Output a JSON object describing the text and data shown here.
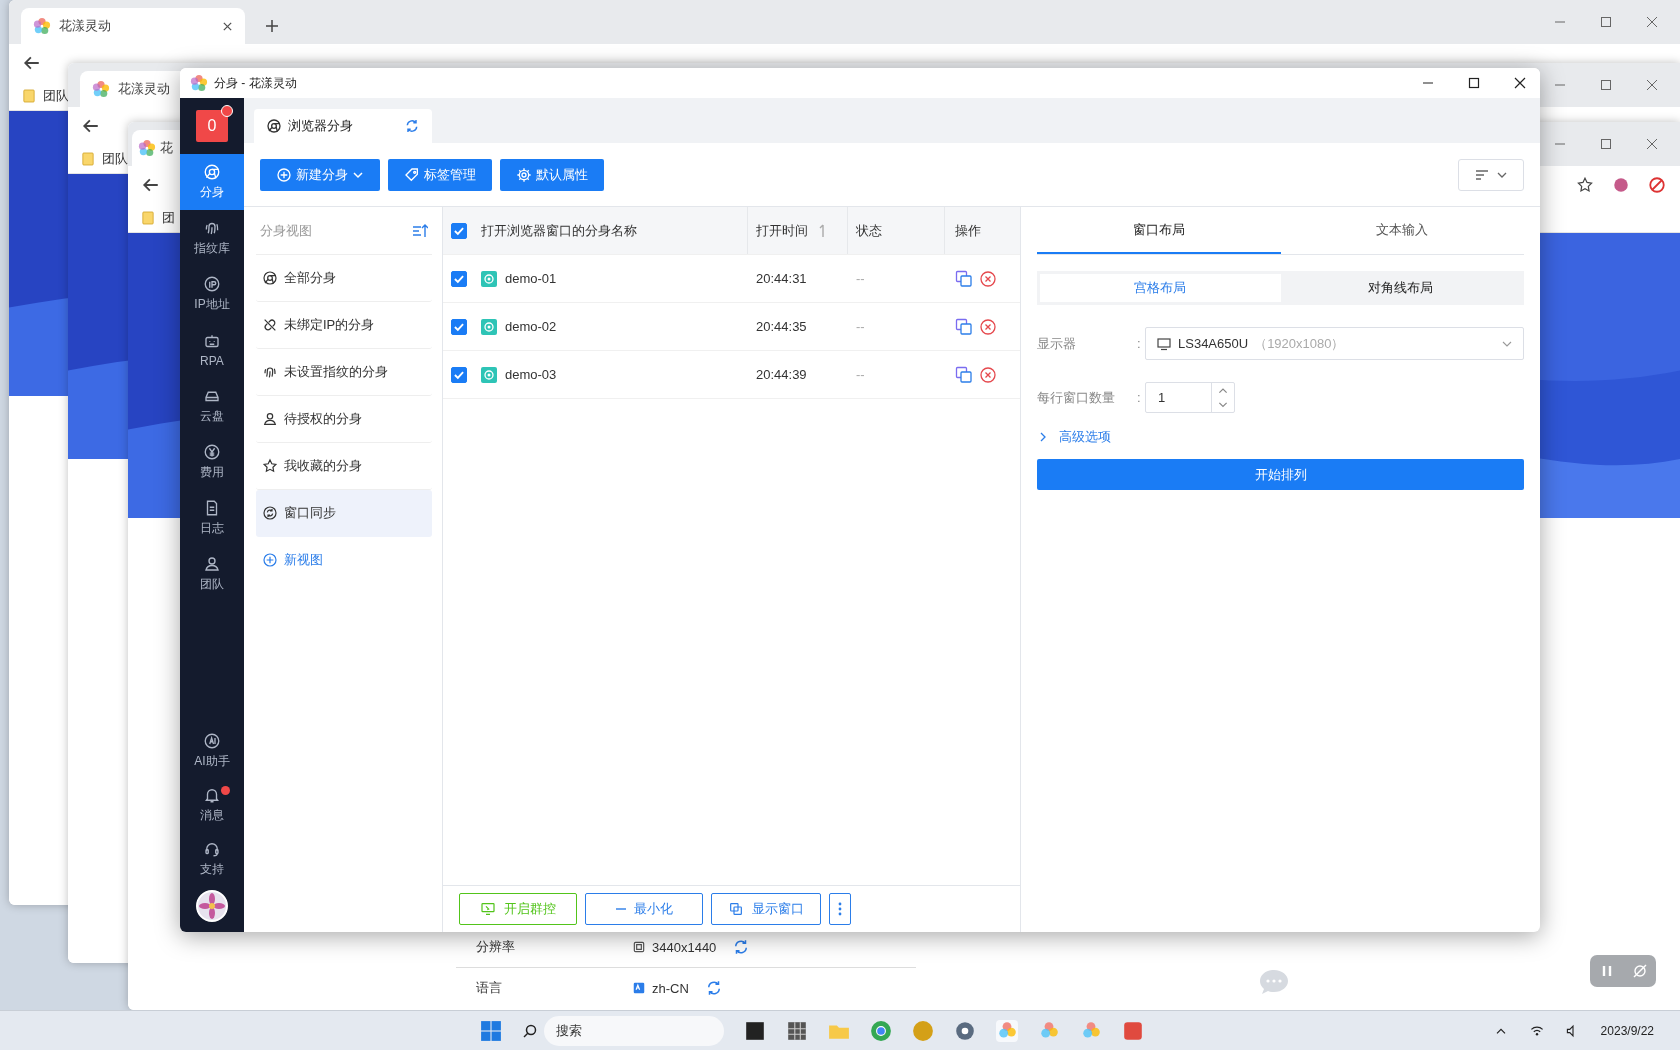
{
  "desktop": {
    "browser_windows": [
      {
        "tab_title": "花漾灵动",
        "bookmark": "团队"
      },
      {
        "tab_title": "花漾灵动",
        "bookmark": "团队"
      },
      {
        "tab_title": "花",
        "bookmark": "团"
      }
    ],
    "settings_rows": [
      {
        "label": "分辨率",
        "value": "3440x1440"
      },
      {
        "label": "语言",
        "value": "zh-CN"
      }
    ]
  },
  "app": {
    "window": {
      "title": "分身 - 花漾灵动"
    },
    "sidebar": {
      "badge": "0",
      "badge_dot": true,
      "items": [
        {
          "label": "分身",
          "selected": true,
          "dot": false
        },
        {
          "label": "指纹库",
          "selected": false,
          "dot": false
        },
        {
          "label": "IP地址",
          "selected": false,
          "dot": false
        },
        {
          "label": "RPA",
          "selected": false,
          "dot": false
        },
        {
          "label": "云盘",
          "selected": false,
          "dot": false
        },
        {
          "label": "费用",
          "selected": false,
          "dot": false
        },
        {
          "label": "日志",
          "selected": false,
          "dot": false
        },
        {
          "label": "团队",
          "selected": false,
          "dot": false
        }
      ],
      "bottom_items": [
        {
          "label": "AI助手",
          "selected": false,
          "dot": false
        },
        {
          "label": "消息",
          "selected": false,
          "dot": true
        },
        {
          "label": "支持",
          "selected": false,
          "dot": false
        }
      ]
    },
    "tab": {
      "label": "浏览器分身"
    },
    "toolbar": [
      {
        "label": "新建分身",
        "dropdown": true
      },
      {
        "label": "标签管理",
        "dropdown": false
      },
      {
        "label": "默认属性",
        "dropdown": false
      }
    ],
    "views": {
      "title": "分身视图",
      "items": [
        {
          "label": "全部分身",
          "selected": false
        },
        {
          "label": "未绑定IP的分身",
          "selected": false
        },
        {
          "label": "未设置指纹的分身",
          "selected": false
        },
        {
          "label": "待授权的分身",
          "selected": false
        },
        {
          "label": "我收藏的分身",
          "selected": false
        },
        {
          "label": "窗口同步",
          "selected": true
        }
      ],
      "new_view": "新视图"
    },
    "table": {
      "all_checked": true,
      "columns": [
        "打开浏览器窗口的分身名称",
        "打开时间",
        "状态",
        "操作"
      ],
      "rows": [
        {
          "checked": true,
          "name": "demo-01",
          "open_time": "20:44:31",
          "status": "--"
        },
        {
          "checked": true,
          "name": "demo-02",
          "open_time": "20:44:35",
          "status": "--"
        },
        {
          "checked": true,
          "name": "demo-03",
          "open_time": "20:44:39",
          "status": "--"
        }
      ],
      "actions": [
        {
          "label": "开启群控",
          "kind": "group"
        },
        {
          "label": "最小化",
          "kind": "minimize"
        },
        {
          "label": "显示窗口",
          "kind": "show"
        }
      ]
    },
    "panel": {
      "tabs": [
        {
          "label": "窗口布局",
          "selected": true
        },
        {
          "label": "文本输入",
          "selected": false
        }
      ],
      "modes": [
        {
          "label": "宫格布局",
          "selected": true
        },
        {
          "label": "对角线布局",
          "selected": false
        }
      ],
      "monitor": {
        "label": "显示器",
        "colon": ":",
        "value": "LS34A650U",
        "resolution": "（1920x1080）"
      },
      "per_row": {
        "label": "每行窗口数量",
        "colon": ":",
        "value": "1"
      },
      "advanced": {
        "label": "高级选项",
        "expanded": false
      },
      "submit": "开始排列"
    }
  },
  "taskbar": {
    "search_placeholder": "搜索",
    "date": "2023/9/22"
  }
}
